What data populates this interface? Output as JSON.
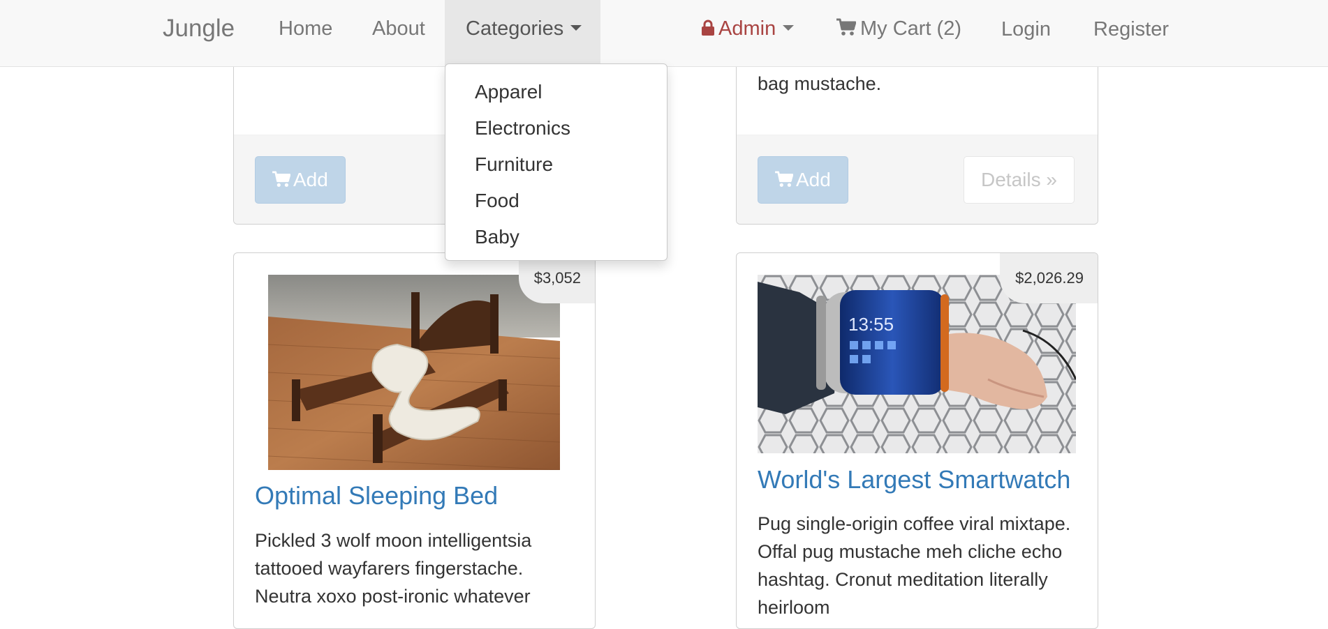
{
  "navbar": {
    "brand": "Jungle",
    "links": {
      "home": "Home",
      "about": "About",
      "categories": "Categories",
      "admin": "Admin",
      "cart": "My Cart (2)",
      "login": "Login",
      "register": "Register"
    },
    "icons": {
      "admin": "lock-icon",
      "cart": "shopping-cart-icon"
    },
    "colors": {
      "background": "#f8f8f8",
      "admin": "#a94442"
    }
  },
  "categories_menu": {
    "items": [
      "Apparel",
      "Electronics",
      "Furniture",
      "Food",
      "Baby"
    ]
  },
  "top_left_card": {
    "add_label": "Add"
  },
  "top_right_card": {
    "text_tail": "bag mustache.",
    "add_label": "Add",
    "details_label": "Details »"
  },
  "products": [
    {
      "name": "Optimal Sleeping Bed",
      "price": "$3,052",
      "description": "Pickled 3 wolf moon intelligentsia tattooed wayfarers fingerstache. Neutra xoxo post-ironic whatever"
    },
    {
      "name": "World's Largest Smartwatch",
      "price": "$2,026.29",
      "description": "Pug single-origin coffee viral mixtape. Offal pug mustache meh cliche echo hashtag. Cronut meditation literally heirloom"
    }
  ],
  "colors": {
    "link": "#337ab7",
    "add_button": "#bfd5e8",
    "price_tag": "#eeeeee"
  }
}
